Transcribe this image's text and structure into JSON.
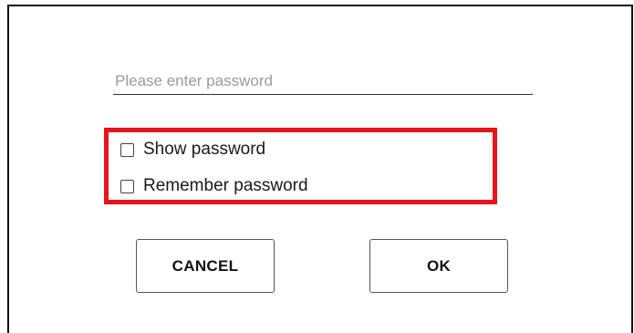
{
  "dialog": {
    "password_field": {
      "value": "",
      "placeholder": "Please enter password"
    },
    "options": [
      {
        "label": "Show password",
        "checked": false
      },
      {
        "label": "Remember password",
        "checked": false
      }
    ],
    "highlight_color": "#e8141b",
    "buttons": {
      "cancel_label": "CANCEL",
      "ok_label": "OK"
    }
  }
}
